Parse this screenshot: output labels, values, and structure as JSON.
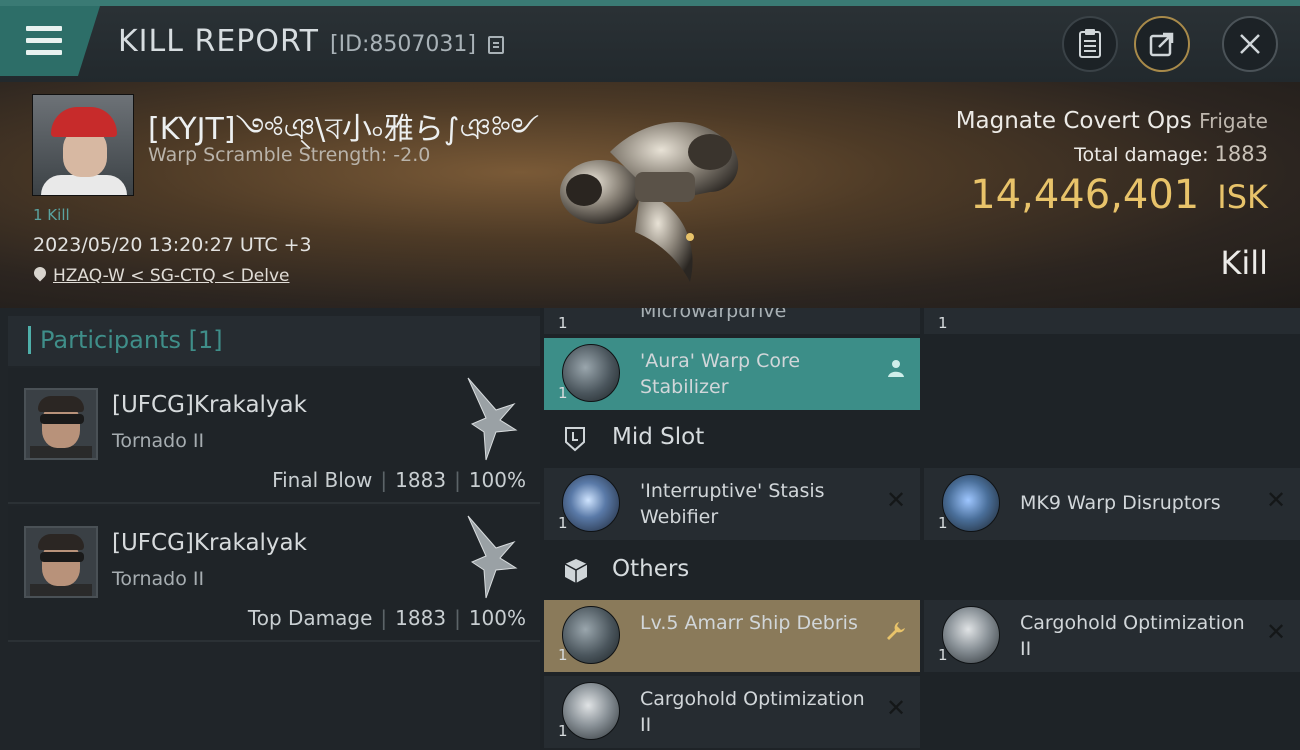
{
  "header": {
    "title": "KILL REPORT",
    "report_id": "[ID:8507031]",
    "buttons": {
      "clipboard": "clipboard-icon",
      "share": "share-icon",
      "close": "close-icon"
    }
  },
  "victim": {
    "name": "[KYJT]༺ঞ্\\ব小৹雅ら∫ঞ༻",
    "warp_scramble": "Warp Scramble Strength: -2.0",
    "kill_count": "1 Kill",
    "datetime": "2023/05/20 13:20:27 UTC +3",
    "location": "HZAQ-W < SG-CTQ < Delve",
    "ship_name": "Magnate Covert Ops",
    "ship_class": "Frigate",
    "total_damage_label": "Total damage:",
    "total_damage": "1883",
    "isk_value": "14,446,401",
    "isk_unit": "ISK",
    "result": "Kill"
  },
  "participants": {
    "label": "Participants",
    "count": "[1]",
    "rows": [
      {
        "name": "[UFCG]Krakalyak",
        "ship": "Tornado II",
        "role": "Final Blow",
        "damage": "1883",
        "percent": "100%"
      },
      {
        "name": "[UFCG]Krakalyak",
        "ship": "Tornado II",
        "role": "Top Damage",
        "damage": "1883",
        "percent": "100%"
      }
    ]
  },
  "items": {
    "cut_top": {
      "name": "Microwarpdrive",
      "qty": "1",
      "right_qty": "1"
    },
    "low_item": {
      "name": "'Aura' Warp Core Stabilizer",
      "qty": "1"
    },
    "mid_slot_label": "Mid Slot",
    "mid_items": [
      {
        "name": "'Interruptive' Stasis Webifier",
        "qty": "1"
      },
      {
        "name": "MK9 Warp Disruptors",
        "qty": "1"
      }
    ],
    "others_label": "Others",
    "other_items": [
      {
        "name": "Lv.5 Amarr Ship Debris",
        "qty": "1"
      },
      {
        "name": "Cargohold Optimization II",
        "qty": "1"
      },
      {
        "name": "Cargohold Optimization II",
        "qty": "1"
      }
    ]
  },
  "colors": {
    "accent": "#3c8e88",
    "isk": "#e8c36a",
    "gold_row": "#8a7a5a"
  }
}
